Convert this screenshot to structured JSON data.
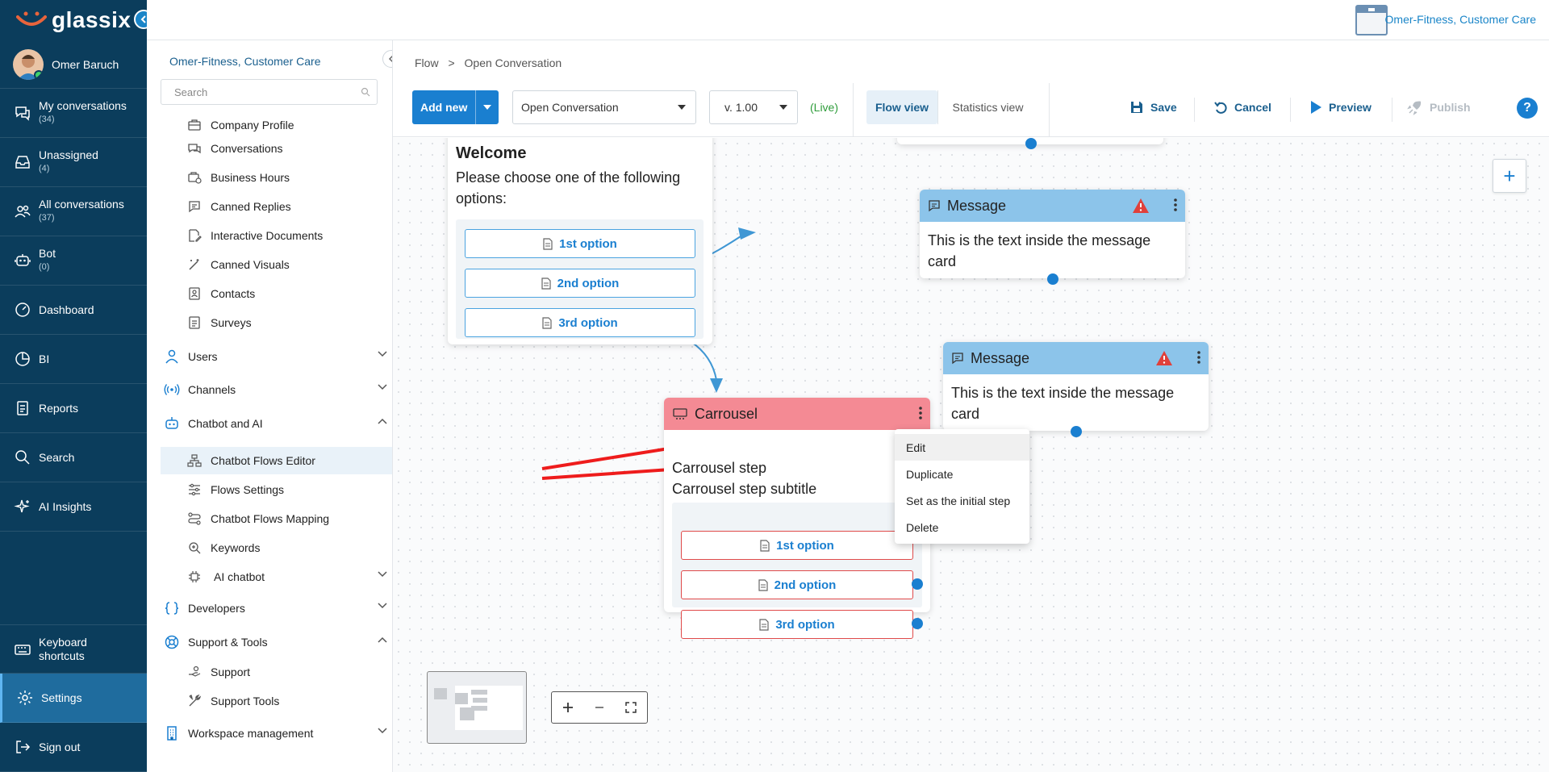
{
  "app": {
    "logo": "glassix"
  },
  "user": {
    "name": "Omer Baruch"
  },
  "workspace": {
    "name": "Omer-Fitness, Customer Care"
  },
  "nav": {
    "items": [
      {
        "label": "My conversations",
        "count": "(34)",
        "icon": "chat-icon"
      },
      {
        "label": "Unassigned",
        "count": "(4)",
        "icon": "inbox-icon"
      },
      {
        "label": "All conversations",
        "count": "(37)",
        "icon": "people-icon"
      },
      {
        "label": "Bot",
        "count": "(0)",
        "icon": "robot-icon"
      },
      {
        "label": "Dashboard",
        "count": "",
        "icon": "dashboard-icon"
      },
      {
        "label": "BI",
        "count": "",
        "icon": "pie-icon"
      },
      {
        "label": "Reports",
        "count": "",
        "icon": "report-icon"
      },
      {
        "label": "Search",
        "count": "",
        "icon": "search-icon"
      },
      {
        "label": "AI Insights",
        "count": "",
        "icon": "sparkle-icon"
      }
    ],
    "bottom": [
      {
        "label": "Keyboard shortcuts",
        "icon": "keyboard-icon"
      },
      {
        "label": "Settings",
        "icon": "gear-icon"
      },
      {
        "label": "Sign out",
        "icon": "signout-icon"
      }
    ]
  },
  "settings": {
    "org_title": "Omer-Fitness, Customer Care",
    "search_placeholder": "Search",
    "items": [
      {
        "label": "Company Profile"
      },
      {
        "label": "Conversations"
      },
      {
        "label": "Business Hours"
      },
      {
        "label": "Canned Replies"
      },
      {
        "label": "Interactive Documents"
      },
      {
        "label": "Canned Visuals"
      },
      {
        "label": "Contacts"
      },
      {
        "label": "Surveys"
      }
    ],
    "sections": [
      {
        "label": "Users"
      },
      {
        "label": "Channels"
      },
      {
        "label": "Chatbot and AI"
      }
    ],
    "chatbot_items": [
      {
        "label": "Chatbot Flows Editor"
      },
      {
        "label": "Flows Settings"
      },
      {
        "label": "Chatbot Flows Mapping"
      },
      {
        "label": "Keywords"
      },
      {
        "label": "AI chatbot"
      }
    ],
    "sections2": [
      {
        "label": "Developers"
      },
      {
        "label": "Support & Tools"
      }
    ],
    "support_items": [
      {
        "label": "Support"
      },
      {
        "label": "Support Tools"
      }
    ],
    "workspace_mgmt": "Workspace management"
  },
  "breadcrumb": {
    "root": "Flow",
    "sep": ">",
    "current": "Open Conversation"
  },
  "toolbar": {
    "add_new": "Add new",
    "flow_select": "Open Conversation",
    "version": "v. 1.00",
    "live": "(Live)",
    "flow_view": "Flow view",
    "stats_view": "Statistics view",
    "save": "Save",
    "cancel": "Cancel",
    "preview": "Preview",
    "publish": "Publish",
    "help": "?"
  },
  "canvas": {
    "welcome": {
      "title": "Welcome",
      "text": "Please choose one of the following options:",
      "options": [
        "1st option",
        "2nd option",
        "3rd option"
      ]
    },
    "message1": {
      "title": "Message",
      "text": "This is the text inside the message card"
    },
    "message2": {
      "title": "Message",
      "text": "This is the text inside the message card"
    },
    "carousel": {
      "title": "Carrousel",
      "step": "Carrousel step",
      "subtitle": "Carrousel step subtitle",
      "options": [
        "1st option",
        "2nd option",
        "3rd option"
      ]
    },
    "context_menu": [
      "Edit",
      "Duplicate",
      "Set as the initial step",
      "Delete"
    ]
  },
  "colors": {
    "nav_bg": "#0b3d5c",
    "accent": "#1a7fd0",
    "message_head": "#8cc4ea",
    "carousel_head": "#f48a94"
  }
}
